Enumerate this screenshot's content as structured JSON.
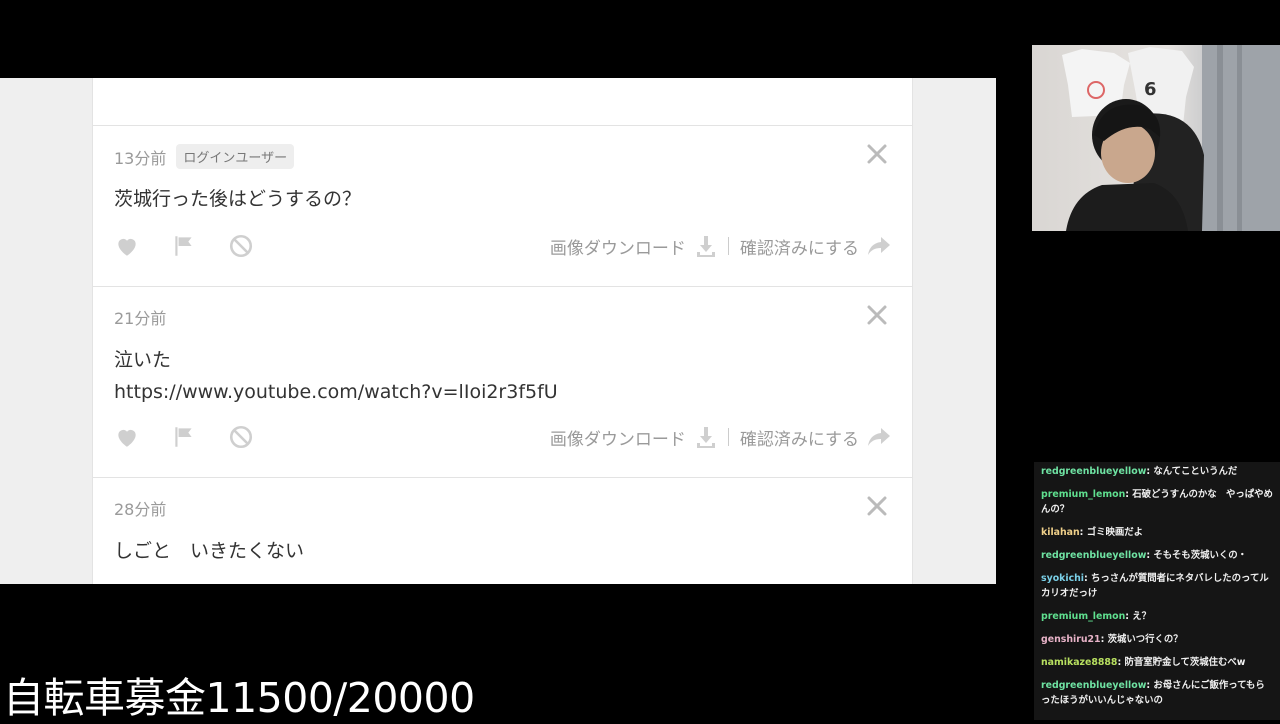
{
  "feed": {
    "download_label": "画像ダウンロード",
    "mark_done_label": "確認済みにする",
    "questions": [
      {
        "time": "13分前",
        "badge": "ログインユーザー",
        "lines": [
          "茨城行った後はどうするの？"
        ]
      },
      {
        "time": "21分前",
        "lines": [
          "泣いた",
          "https://www.youtube.com/watch?v=lIoi2r3f5fU"
        ]
      },
      {
        "time": "28分前",
        "lines": [
          "しごと　いきたくない"
        ]
      }
    ]
  },
  "chat": {
    "messages": [
      {
        "user": "redgreenblueyellow",
        "color": "#6fe3a3",
        "text": "なんてこというんだ"
      },
      {
        "user": "premium_lemon",
        "color": "#5fe08f",
        "text": "石破どうすんのかな　やっぱやめんの？"
      },
      {
        "user": "kilahan",
        "color": "#f0d08a",
        "text": "ゴミ映画だよ"
      },
      {
        "user": "redgreenblueyellow",
        "color": "#6fe3a3",
        "text": "そもそも茨城いくの・"
      },
      {
        "user": "syokichi",
        "color": "#7ad0e8",
        "text": "ちっさんが質問者にネタバレしたのってルカリオだっけ"
      },
      {
        "user": "premium_lemon",
        "color": "#5fe08f",
        "text": "え？"
      },
      {
        "user": "genshiru21",
        "color": "#e8b3c8",
        "text": "茨城いつ行くの？"
      },
      {
        "user": "namikaze8888",
        "color": "#b8e060",
        "text": "防音室貯金して茨城住むべw"
      },
      {
        "user": "redgreenblueyellow",
        "color": "#6fe3a3",
        "text": "お母さんにご飯作ってもらったほうがいいんじゃないの"
      }
    ]
  },
  "goal": {
    "text": "自転車募金11500/20000"
  }
}
